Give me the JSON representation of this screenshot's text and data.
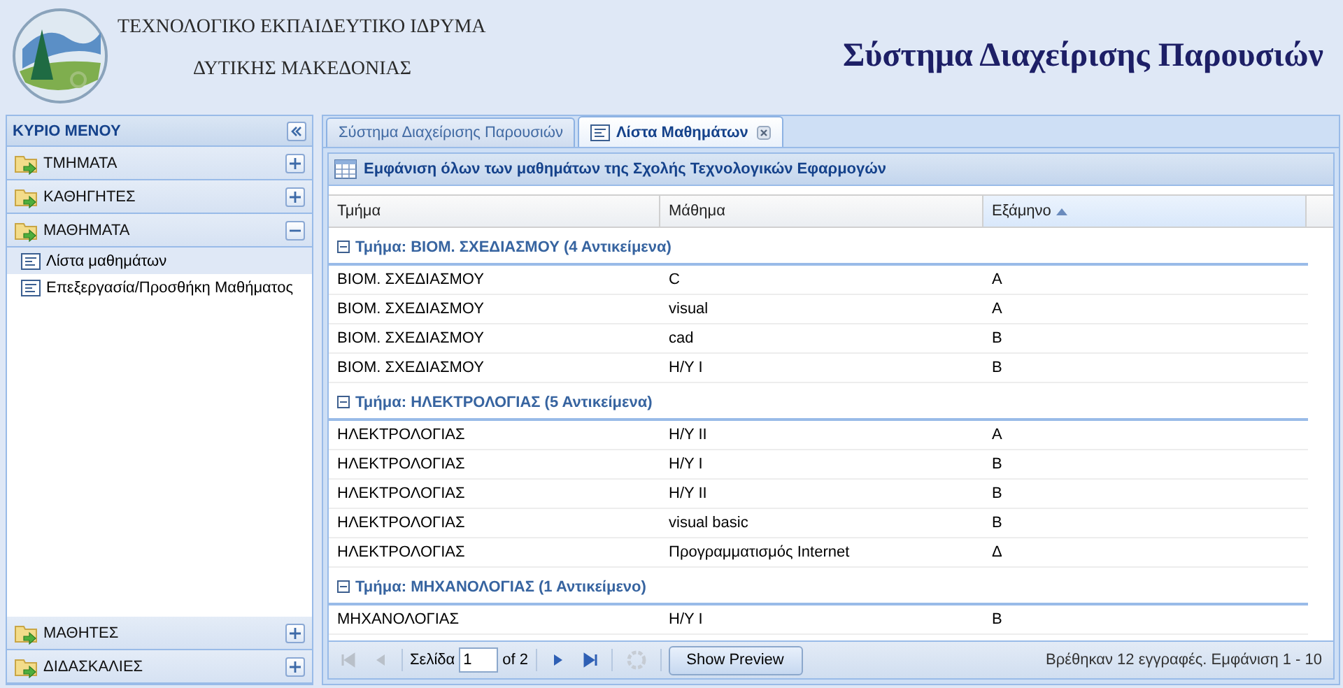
{
  "header": {
    "institution_line_1": "ΤΕΧΝΟΛΟΓΙΚΟ ΕΚΠΑΙΔΕΥΤΙΚΟ ΙΔΡΥΜΑ",
    "institution_line_2": "ΔΥΤΙΚΗΣ ΜΑΚΕΔΟΝΙΑΣ",
    "system_title": "Σύστημα Διαχείρισης Παρουσιών"
  },
  "menu": {
    "title": "ΚΥΡΙΟ ΜΕΝΟΥ",
    "sections": [
      {
        "label": "ΤΜΗΜΑΤΑ",
        "expanded": false
      },
      {
        "label": "ΚΑΘΗΓΗΤΕΣ",
        "expanded": false
      },
      {
        "label": "ΜΑΘΗΜΑΤΑ",
        "expanded": true,
        "children": [
          {
            "label": "Λίστα μαθημάτων",
            "selected": true
          },
          {
            "label": "Επεξεργασία/Προσθήκη Μαθήματος",
            "selected": false
          }
        ]
      },
      {
        "label": "ΜΑΘΗΤΕΣ",
        "expanded": false
      },
      {
        "label": "ΔΙΔΑΣΚΑΛΙΕΣ",
        "expanded": false
      }
    ]
  },
  "tabs": [
    {
      "label": "Σύστημα Διαχείρισης Παρουσιών",
      "selected": false,
      "closable": false
    },
    {
      "label": "Λίστα Μαθημάτων",
      "selected": true,
      "closable": true
    }
  ],
  "panel_title": "Εμφάνιση όλων των μαθημάτων της Σχολής Τεχνολογικών Εφαρμογών",
  "table": {
    "columns": [
      {
        "label": "Τμήμα",
        "sorted": false
      },
      {
        "label": "Μάθημα",
        "sorted": false
      },
      {
        "label": "Εξάμηνο",
        "sorted": true
      }
    ],
    "groups": [
      {
        "label": "Τμήμα: ΒΙΟΜ. ΣΧΕΔΙΑΣΜΟΥ (4 Αντικείμενα)",
        "expanded": true,
        "rows": [
          [
            "ΒΙΟΜ. ΣΧΕΔΙΑΣΜΟΥ",
            "C",
            "Α"
          ],
          [
            "ΒΙΟΜ. ΣΧΕΔΙΑΣΜΟΥ",
            "visual",
            "Α"
          ],
          [
            "ΒΙΟΜ. ΣΧΕΔΙΑΣΜΟΥ",
            "cad",
            "Β"
          ],
          [
            "ΒΙΟΜ. ΣΧΕΔΙΑΣΜΟΥ",
            "Η/Υ Ι",
            "Β"
          ]
        ]
      },
      {
        "label": "Τμήμα: ΗΛΕΚΤΡΟΛΟΓΙΑΣ (5 Αντικείμενα)",
        "expanded": true,
        "rows": [
          [
            "ΗΛΕΚΤΡΟΛΟΓΙΑΣ",
            "Η/Υ ΙΙ",
            "Α"
          ],
          [
            "ΗΛΕΚΤΡΟΛΟΓΙΑΣ",
            "Η/Υ Ι",
            "Β"
          ],
          [
            "ΗΛΕΚΤΡΟΛΟΓΙΑΣ",
            "Η/Υ ΙΙ",
            "Β"
          ],
          [
            "ΗΛΕΚΤΡΟΛΟΓΙΑΣ",
            "visual basic",
            "Β"
          ],
          [
            "ΗΛΕΚΤΡΟΛΟΓΙΑΣ",
            "Προγραμματισμός Internet",
            "Δ"
          ]
        ]
      },
      {
        "label": "Τμήμα: ΜΗΧΑΝΟΛΟΓΙΑΣ (1 Αντικείμενο)",
        "expanded": true,
        "rows": [
          [
            "ΜΗΧΑΝΟΛΟΓΙΑΣ",
            "Η/Υ Ι",
            "Β"
          ]
        ]
      }
    ]
  },
  "pager": {
    "nav": [
      {
        "kind": "first",
        "disabled": true
      },
      {
        "kind": "prev",
        "disabled": true
      }
    ],
    "page_label": "Σελίδα",
    "page": "1",
    "of": "of 2",
    "nav_after": [
      {
        "kind": "next",
        "disabled": false
      },
      {
        "kind": "last",
        "disabled": false
      }
    ],
    "refresh_disabled": true,
    "preview_button": "Show Preview",
    "status": "Βρέθηκαν 12 εγγραφές. Εμφάνιση 1 - 10"
  }
}
